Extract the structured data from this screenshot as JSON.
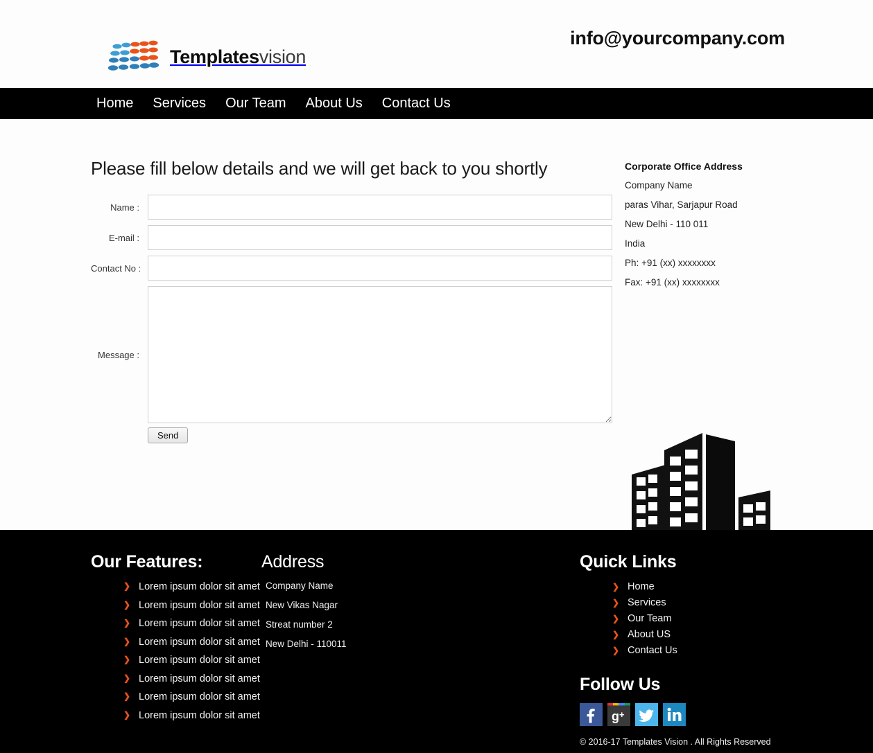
{
  "header": {
    "logo_text_bold": "Templates",
    "logo_text_light": "vision",
    "email": "info@yourcompany.com"
  },
  "nav": {
    "items": [
      {
        "label": "Home"
      },
      {
        "label": "Services"
      },
      {
        "label": "Our Team"
      },
      {
        "label": "About Us"
      },
      {
        "label": "Contact Us"
      }
    ]
  },
  "main": {
    "form_title": "Please fill below details and we will get back to you shortly",
    "fields": [
      {
        "label": "Name :",
        "value": "",
        "placeholder": ""
      },
      {
        "label": "E-mail :",
        "value": "",
        "placeholder": ""
      },
      {
        "label": "Contact No :",
        "value": "",
        "placeholder": ""
      }
    ],
    "message_label": "Message :",
    "message_value": "",
    "send_label": "Send"
  },
  "address_sidebar": {
    "title": "Corporate Office Address",
    "lines": [
      "Company Name",
      "paras Vihar, Sarjapur Road",
      "New Delhi - 110 011",
      "India",
      "Ph: +91 (xx) xxxxxxxx",
      "Fax: +91 (xx) xxxxxxxx"
    ]
  },
  "contact_strip": {
    "label": "Contact US"
  },
  "footer": {
    "features": {
      "heading": "Our Features:",
      "items": [
        "Lorem ipsum dolor sit amet",
        "Lorem ipsum dolor sit amet",
        "Lorem ipsum dolor sit amet",
        "Lorem ipsum dolor sit amet",
        "Lorem ipsum dolor sit amet",
        "Lorem ipsum dolor sit amet",
        "Lorem ipsum dolor sit amet",
        "Lorem ipsum dolor sit amet"
      ]
    },
    "address": {
      "heading": "Address",
      "lines": [
        "Company Name",
        "New Vikas Nagar",
        "Streat number 2",
        "New Delhi - 110011"
      ]
    },
    "quick_links": {
      "heading": "Quick Links",
      "items": [
        {
          "label": "Home"
        },
        {
          "label": "Services"
        },
        {
          "label": "Our Team"
        },
        {
          "label": "About US"
        },
        {
          "label": "Contact Us"
        }
      ]
    },
    "follow": {
      "heading": "Follow Us",
      "socials": [
        {
          "name": "facebook-icon",
          "glyph": "f",
          "color": "#3b5998"
        },
        {
          "name": "google-plus-icon",
          "glyph": "g+",
          "color": "#3a3a3a"
        },
        {
          "name": "twitter-icon",
          "glyph": "t",
          "color": "#4cb5ec"
        },
        {
          "name": "linkedin-icon",
          "glyph": "in",
          "color": "#1d87bf"
        }
      ]
    },
    "copyright": "© 2016-17  Templates Vision  . All Rights Reserved"
  },
  "colors": {
    "nav_bg": "#000000",
    "footer_bg": "#000000",
    "bullet_accent": "#e8531a",
    "page_bg": "#fdfdfd",
    "input_border": "#cfcfcf"
  }
}
